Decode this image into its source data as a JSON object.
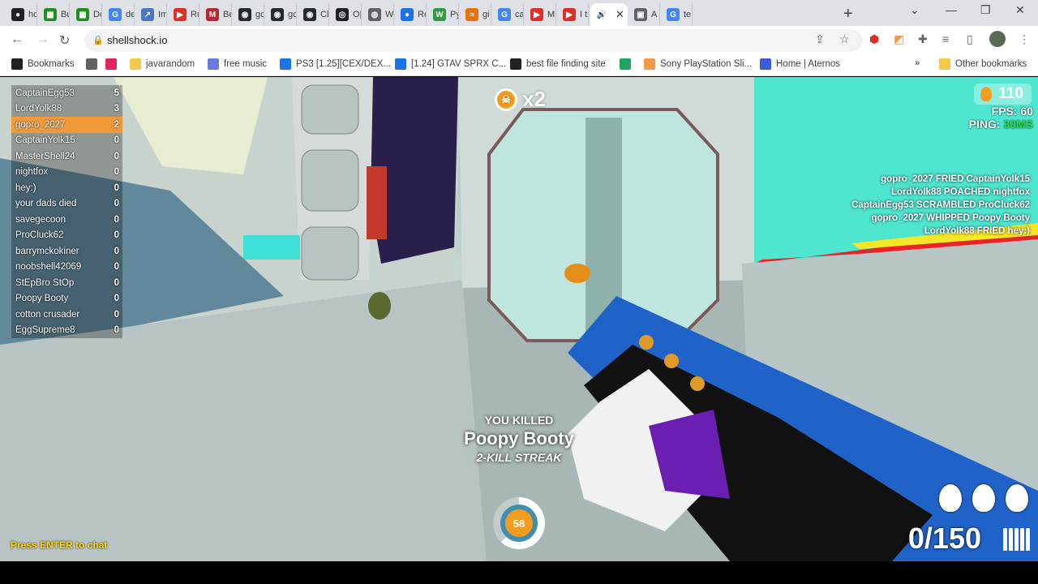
{
  "browser": {
    "tabs": [
      {
        "label": "hc",
        "color": "#202124",
        "glyph": "●"
      },
      {
        "label": "Bu",
        "color": "#1e8f1e",
        "glyph": "▦"
      },
      {
        "label": "Dc",
        "color": "#1e8f1e",
        "glyph": "▦"
      },
      {
        "label": "de",
        "color": "#4285f4",
        "glyph": "G"
      },
      {
        "label": "Im",
        "color": "#4a78c2",
        "glyph": "↗"
      },
      {
        "label": "Ru",
        "color": "#e52d27",
        "glyph": "▶"
      },
      {
        "label": "Be",
        "color": "#b8272c",
        "glyph": "M"
      },
      {
        "label": "gc",
        "color": "#24292f",
        "glyph": "◉"
      },
      {
        "label": "gc",
        "color": "#24292f",
        "glyph": "◉"
      },
      {
        "label": "Cl",
        "color": "#24292f",
        "glyph": "◉"
      },
      {
        "label": "O|",
        "color": "#202124",
        "glyph": "◎"
      },
      {
        "label": "W",
        "color": "#5f6368",
        "glyph": "◍"
      },
      {
        "label": "Re",
        "color": "#1a73e8",
        "glyph": "●"
      },
      {
        "label": "Py",
        "color": "#2e9d42",
        "glyph": "W"
      },
      {
        "label": "gi",
        "color": "#e8710a",
        "glyph": "≈"
      },
      {
        "label": "ca",
        "color": "#4285f4",
        "glyph": "G"
      },
      {
        "label": "M",
        "color": "#e52d27",
        "glyph": "▶"
      },
      {
        "label": "I t",
        "color": "#e52d27",
        "glyph": "▶"
      },
      {
        "label": "",
        "color": "#202124",
        "glyph": "🔊",
        "active": true
      },
      {
        "label": "A",
        "color": "#5f6368",
        "glyph": "▣"
      },
      {
        "label": "te",
        "color": "#4285f4",
        "glyph": "G"
      }
    ],
    "new_tab": "+",
    "window_controls": {
      "chevron": "⌄",
      "minimize": "—",
      "restore": "❐",
      "close": "✕"
    },
    "nav": {
      "back": "←",
      "forward": "→",
      "reload": "↻"
    },
    "url": "shellshock.io",
    "bookmarks": [
      {
        "label": "Bookmarks",
        "color": "#202124"
      },
      {
        "label": "",
        "color": "#5f6368"
      },
      {
        "label": "",
        "color": "#e0245e"
      },
      {
        "label": "javarandom",
        "color": "#f2c94c"
      },
      {
        "label": "free music",
        "color": "#6c7ae0"
      },
      {
        "label": "PS3 [1.25][CEX/DEX...",
        "color": "#1a73e8"
      },
      {
        "label": "[1.24] GTAV SPRX C...",
        "color": "#1a73e8"
      },
      {
        "label": "best file finding site",
        "color": "#202124"
      },
      {
        "label": "",
        "color": "#21a366"
      },
      {
        "label": "Sony PlayStation Sli...",
        "color": "#f2994a"
      },
      {
        "label": "Home | Aternos",
        "color": "#3b5bdb"
      }
    ],
    "bookmarks_more": "»",
    "other_bookmarks": "Other bookmarks"
  },
  "game": {
    "scoreboard": [
      {
        "name": "CaptainEgg53",
        "score": "5"
      },
      {
        "name": "LordYolk88",
        "score": "3"
      },
      {
        "name": "gopro_2027",
        "score": "2",
        "me": true
      },
      {
        "name": "CaptainYolk15",
        "score": "0"
      },
      {
        "name": "MasterShell24",
        "score": "0"
      },
      {
        "name": "nightfox",
        "score": "0"
      },
      {
        "name": "hey:)",
        "score": "0"
      },
      {
        "name": "your dads died",
        "score": "0"
      },
      {
        "name": "savegecoon",
        "score": "0"
      },
      {
        "name": "ProCluck62",
        "score": "0"
      },
      {
        "name": "barrymckokiner",
        "score": "0"
      },
      {
        "name": "noobshell42069",
        "score": "0"
      },
      {
        "name": "StEpBro StOp",
        "score": "0"
      },
      {
        "name": "Poopy Booty",
        "score": "0"
      },
      {
        "name": "cotton crusader",
        "score": "0"
      },
      {
        "name": "EggSupreme8",
        "score": "0"
      }
    ],
    "egg_count": "110",
    "fps_label": "FPS:",
    "fps_value": "60",
    "ping_label": "PING:",
    "ping_value": "30MS",
    "streak_multiplier": "x2",
    "killfeed": [
      "gopro_2027 FRIED CaptainYolk15",
      "LordYolk88 POACHED nightfox",
      "CaptainEgg53 SCRAMBLED ProCluck62",
      "gopro_2027 WHIPPED Poopy Booty",
      "LordYolk88 FRIED hey:)"
    ],
    "kill_title": "YOU KILLED",
    "kill_victim": "Poopy Booty",
    "kill_streak": "2-KILL STREAK",
    "health": "58",
    "health_fraction": 0.62,
    "chat_prompt": "Press ENTER to chat",
    "ammo": "0/150",
    "grenades": 3
  }
}
